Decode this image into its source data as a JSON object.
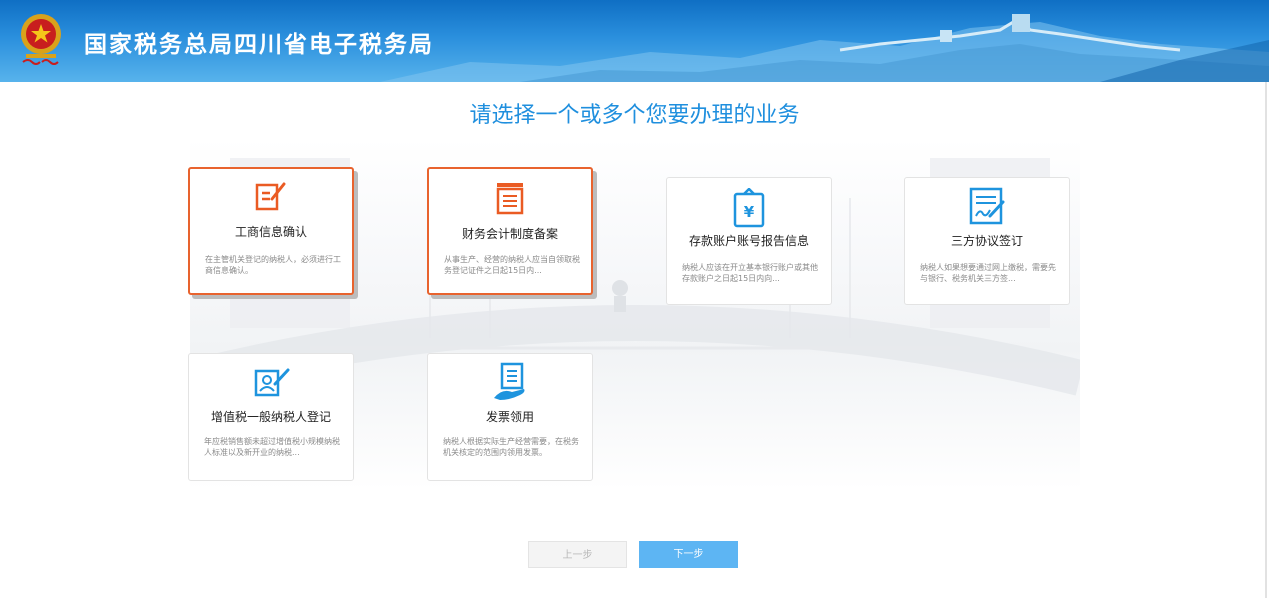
{
  "header": {
    "site_title": "国家税务总局四川省电子税务局"
  },
  "main": {
    "heading": "请选择一个或多个您要办理的业务"
  },
  "cards": [
    {
      "title": "工商信息确认",
      "desc": "在主管机关登记的纳税人，必须进行工商信息确认。",
      "icon": "edit-document-icon",
      "selected": true
    },
    {
      "title": "财务会计制度备案",
      "desc": "从事生产、经营的纳税人应当自领取税务登记证件之日起15日内...",
      "icon": "list-document-icon",
      "selected": true
    },
    {
      "title": "存款账户账号报告信息",
      "desc": "纳税人应该在开立基本银行账户或其他存款账户之日起15日内向...",
      "icon": "yuan-bag-icon",
      "selected": false
    },
    {
      "title": "三方协议签订",
      "desc": "纳税人如果想要通过网上缴税，需要先与银行、税务机关三方签...",
      "icon": "sign-agreement-icon",
      "selected": false
    },
    {
      "title": "增值税一般纳税人登记",
      "desc": "年应税销售额未超过增值税小规模纳税人标准以及新开业的纳税...",
      "icon": "person-register-icon",
      "selected": false
    },
    {
      "title": "发票领用",
      "desc": "纳税人根据实际生产经营需要，在税务机关核定的范围内领用发票。",
      "icon": "invoice-hand-icon",
      "selected": false
    }
  ],
  "buttons": {
    "prev_label": "上一步",
    "next_label": "下一步"
  },
  "colors": {
    "accent": "#1f8fde",
    "selected_border": "#e8632e",
    "header_blue": "#1a7fd4",
    "next_button": "#5db5f3"
  }
}
